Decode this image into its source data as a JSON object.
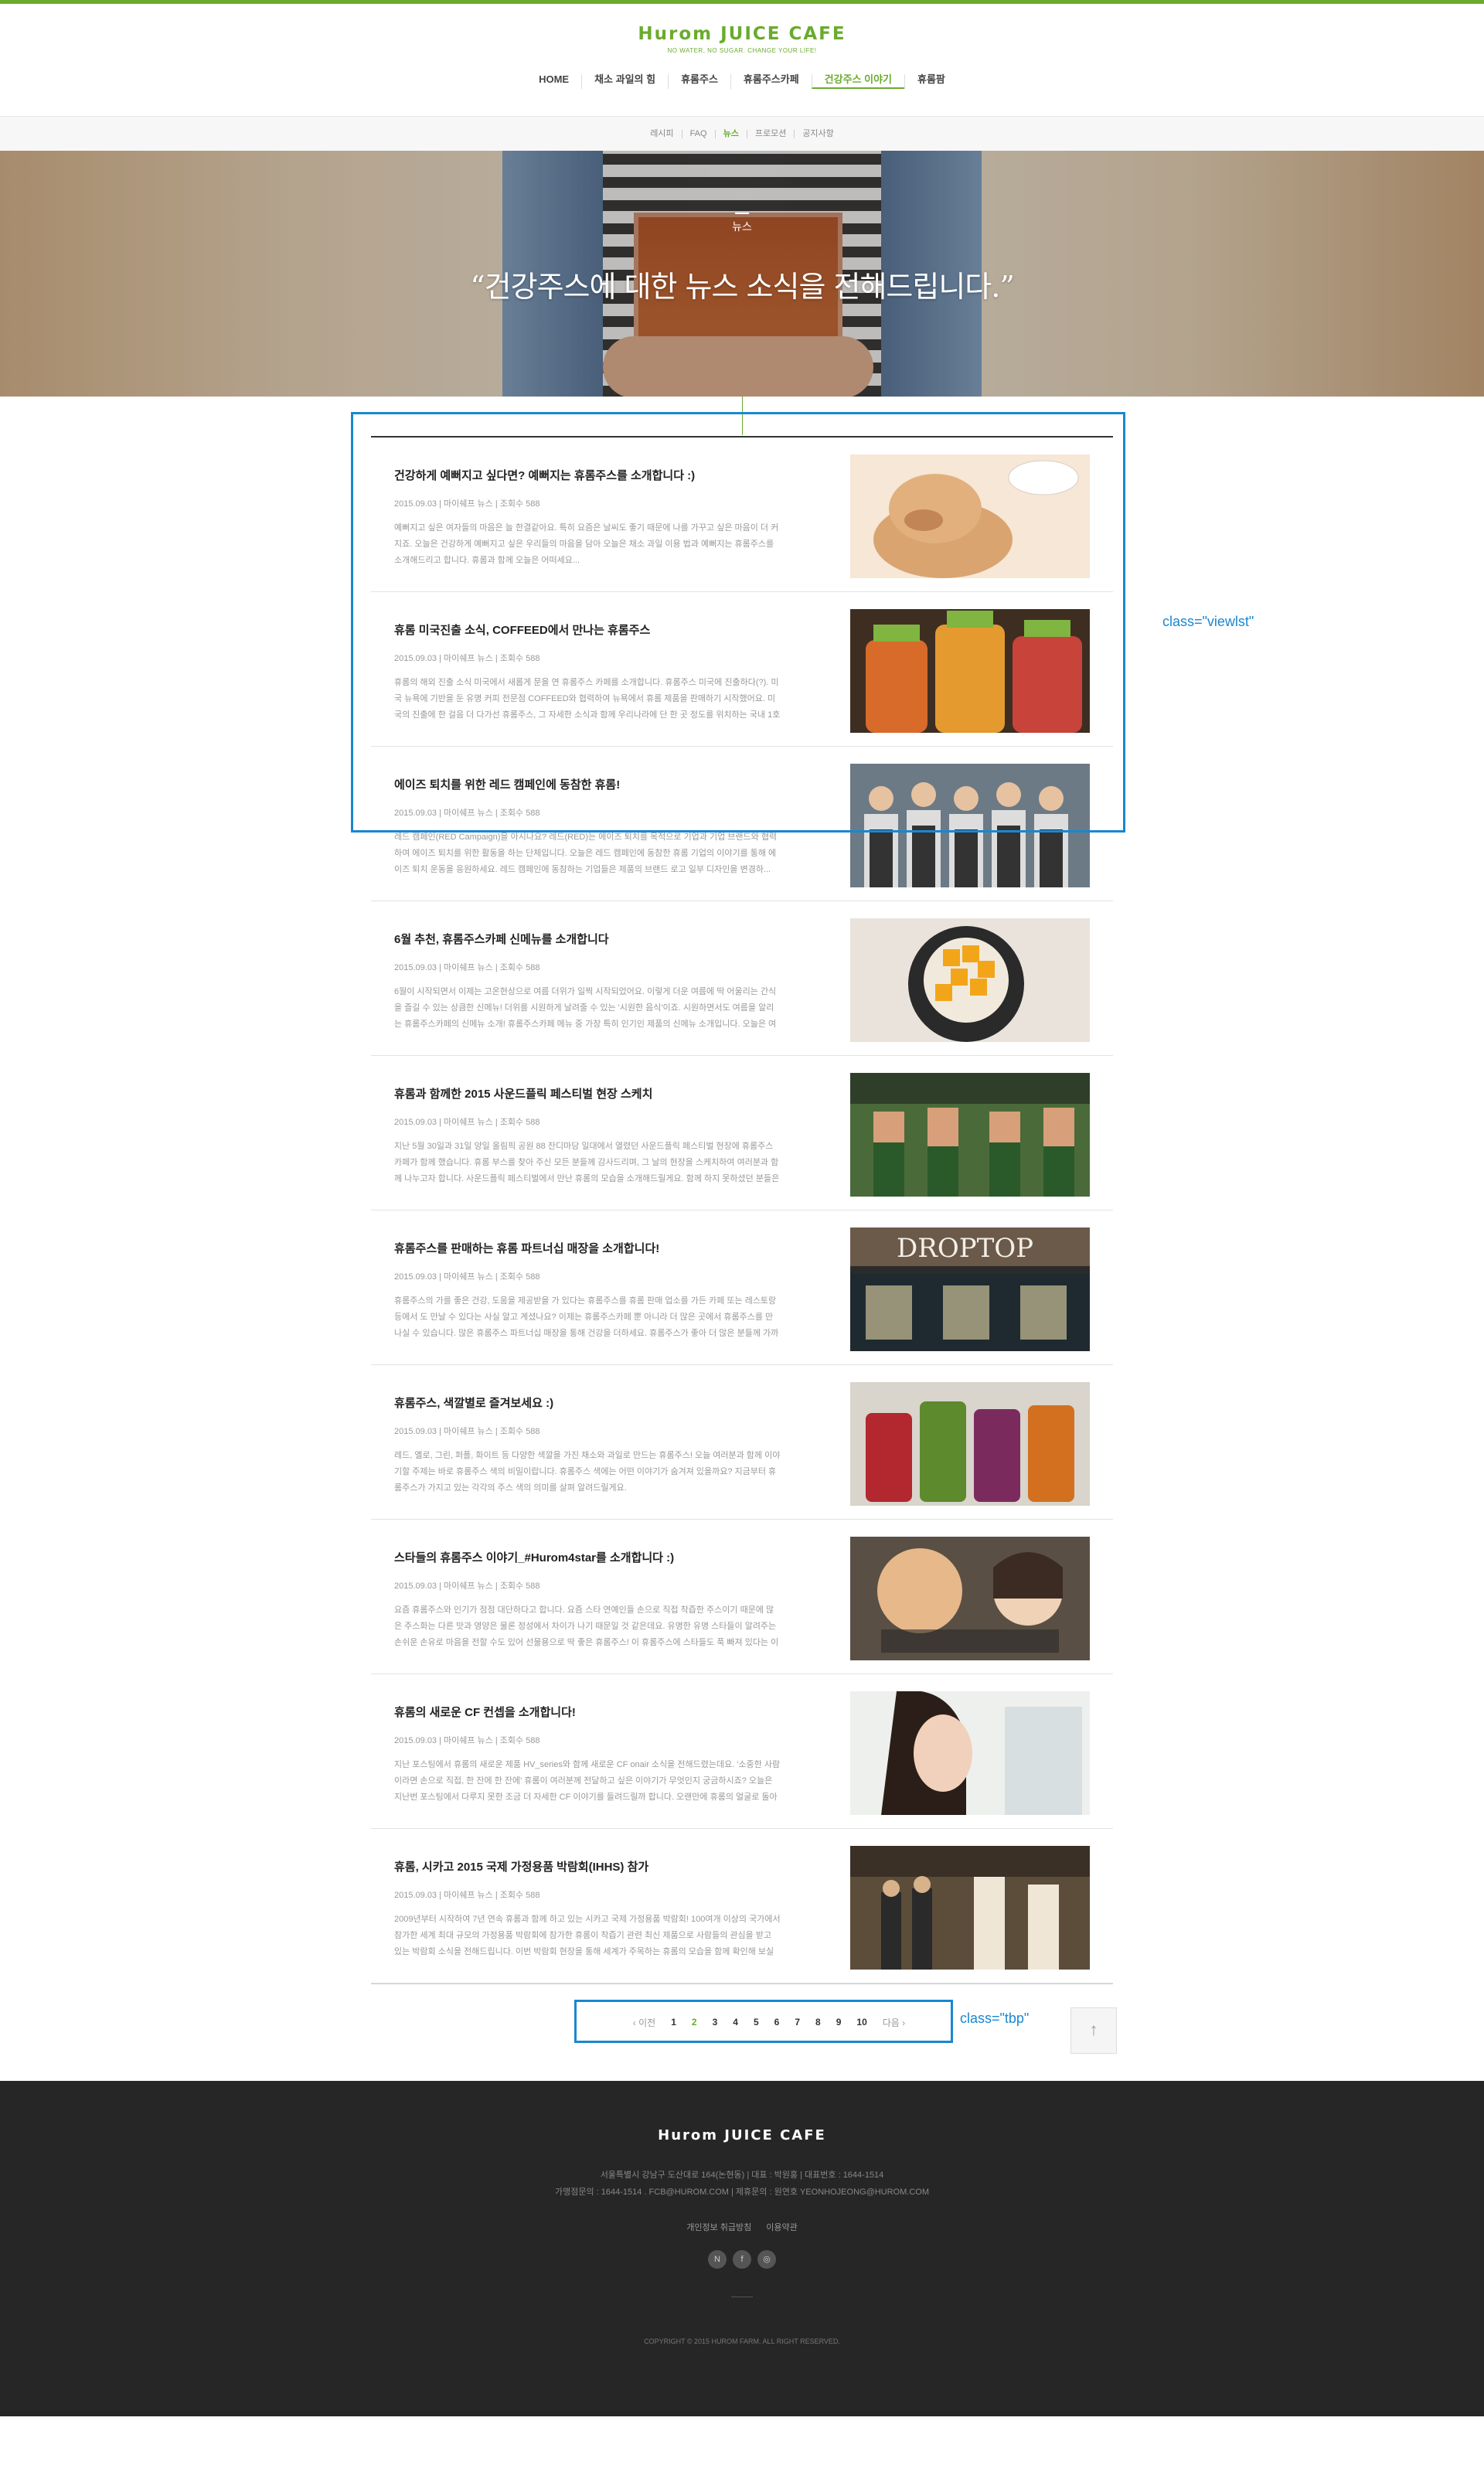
{
  "brand": {
    "logo": "Hurom JUICE CAFE",
    "tagline": "NO WATER, NO SUGAR. CHANGE YOUR LIFE!",
    "accent": "#6aab2e"
  },
  "gnb": [
    "HOME",
    "채소 과일의 힘",
    "휴롬주스",
    "휴롬주스카페",
    "건강주스 이야기",
    "휴롬팜"
  ],
  "subnav": [
    "레시피",
    "FAQ",
    "뉴스",
    "프로모션",
    "공지사항"
  ],
  "hero": {
    "badge": "뉴스",
    "quote": "“건강주스에 대한 뉴스 소식을 전해드립니다.”"
  },
  "annotations": {
    "list": "class=\"viewlst\"",
    "pager": "class=\"tbp\""
  },
  "articles": [
    {
      "title": "건강하게 예뻐지고 싶다면? 예뻐지는 휴롬주스를 소개합니다 :)",
      "meta": "2015.09.03 | 마이쉐프 뉴스 | 조회수 588",
      "body": "예뻐지고 싶은 여자들의 마음은 늘 한결같아요. 특히 요즘은 날씨도 좋기 때문에 나를 가꾸고 싶은 마음이 더 커지죠. 오늘은 건강하게 예뻐지고 싶은 우리들의 마음을 담아 오늘은 채소 과일 이용 법과 예뻐지는 휴롬주스를 소개해드리고 합니다. 휴롬과 함께 오늘은 어떠세요..."
    },
    {
      "title": "휴롬 미국진출 소식, COFFEED에서 만나는 휴롬주스",
      "meta": "2015.09.03 | 마이쉐프 뉴스 | 조회수 588",
      "body": "휴롬의 해외 진출 소식 미국에서 새롭게 문을 연 휴롬주스 카페를 소개합니다. 휴롬주스 미국에 진출하다(?). 미국 뉴욕에 기반을 둔 유명 커피 전문점 COFFEED와 협력하여 뉴욕에서 휴롬 제품을 판매하기 시작했어요. 미국의 진출에 한 걸음 더 다가선 휴롬주스, 그 자세한 소식과 함께 우리나라에 단 한 곳 정도를 위치하는 국내 1호점 카페도 소개..."
    },
    {
      "title": "에이즈 퇴치를 위한 레드 캠페인에 동참한 휴롬!",
      "meta": "2015.09.03 | 마이쉐프 뉴스 | 조회수 588",
      "body": "레드 캠페인(RED Campaign)을 아시나요? 레드(RED)는 에이즈 퇴치를 목적으로 기업과 기업 브랜드와 협력하여 에이즈 퇴치를 위한 활동을 하는 단체입니다. 오늘은 레드 캠페인에 동참한 휴롬 기업의 이야기를 통해 에이즈 퇴치 운동을 응원하세요. 레드 캠페인에 동참하는 기업들은 제품의 브랜드 로고 일부 디자인을 변경하..."
    },
    {
      "title": "6월 추천, 휴롬주스카페 신메뉴를 소개합니다",
      "meta": "2015.09.03 | 마이쉐프 뉴스 | 조회수 588",
      "body": "6월이 시작되면서 이제는 고온현상으로 여름 더위가 일찍 시작되었어요. 이렇게 더운 여름에 딱 어울리는 간식을 즐길 수 있는 상큼한 신메뉴! 더위를 시원하게 날려줄 수 있는 '시원한 음식'이죠. 시원하면서도 여름을 알리는 휴롬주스카페의 신메뉴 소개! 휴롬주스카페 메뉴 중 가장 특히 인기인 제품의 신메뉴 소개입니다. 오늘은 여러분이 건강한 여름을 위해 휴롬주스카페에서 새로 나온 신메뉴..."
    },
    {
      "title": "휴롬과 함께한 2015 사운드플릭 페스티벌 현장 스케치",
      "meta": "2015.09.03 | 마이쉐프 뉴스 | 조회수 588",
      "body": "지난 5월 30일과 31일 양일 올림픽 공원 88 잔디마당 일대에서 열렸던 사운드플릭 페스티벌 현장에 휴롬주스카페가 함께 했습니다. 휴롬 부스를 찾아 주신 모든 분들께 감사드리며, 그 날의 현장을 스케치하여 여러분과 함께 나누고자 합니다. 사운드플릭 페스티벌에서 만난 휴롬의 모습을 소개해드릴게요. 함께 하지 못하셨던 분들은 휴롬이 들려드리는 사운드플릭 페스티벌 생..."
    },
    {
      "title": "휴롬주스를 판매하는 휴롬 파트너십 매장을 소개합니다!",
      "meta": "2015.09.03 | 마이쉐프 뉴스 | 조회수 588",
      "body": "휴롬주스의 가를 좋은 건강, 도움을 제공받을 가 있다는 휴롬주스를 휴롬 판매 업소를 가든 카페 또는 레스토랑 등에서 도 만날 수 있다는 사실 알고 계셨나요? 이제는 휴롬주스카페 뿐 아니라 더 많은 곳에서 휴롬주스를 만나실 수 있습니다. 많은 휴롬주스 파트너십 매장을 통해 건강을 더하세요. 휴롬주스가 좋아 더 많은 분들께 가까이 다가가고자 합은..."
    },
    {
      "title": "휴롬주스, 색깔별로 즐겨보세요 :)",
      "meta": "2015.09.03 | 마이쉐프 뉴스 | 조회수 588",
      "body": "레드, 옐로, 그린, 퍼플, 화이트 등 다양한 색깔을 가진 채소와 과일로 만드는 휴롬주스! 오늘 여러분과 함께 이야기할 주제는 바로 휴롬주스 색의 비밀이랍니다. 휴롬주스 색에는 어떤 이야기가 숨겨져 있을까요? 지금부터 휴롬주스가 가지고 있는 각각의 주스 색의 의미를 살펴 알려드릴게요."
    },
    {
      "title": "스타들의 휴롬주스 이야기_#Hurom4star를 소개합니다 :)",
      "meta": "2015.09.03 | 마이쉐프 뉴스 | 조회수 588",
      "body": "요즘 휴롬주스와 인기가 점점 대단하다고 합니다. 요즘 스타 연예인들 손으로 직접 착즙한 주스이기 때문에 많은 주스화는 다른 맛과 영양은 물론 정성에서 차이가 나기 때문일 것 같은데요. 유명한 유명 스타들이 알려주는 손쉬운 손유로 마음을 전할 수도 있어 선물용으로 딱 좋은 휴롬주스! 이 휴롬주스에 스타들도 푹 빠져 있다는 이야..."
    },
    {
      "title": "휴롬의 새로운 CF 컨셉을 소개합니다!",
      "meta": "2015.09.03 | 마이쉐프 뉴스 | 조회수 588",
      "body": "지난 포스팅에서 휴롬의 새로운 제품 HV_series와 함께 새로운 CF onair 소식을 전해드렸는데요. '소중한 사람이라면 손으로 직접, 한 잔에 한 잔에' 휴롬이 여러분께 전달하고 싶은 이야기가 무엇인지 궁금하시죠? 오늘은 지난번 포스팅에서 다루지 못한 조금 더 자세한 CF 이야기를 들려드릴까 합니다. 오랜만에 휴롬의 얼굴로 돌아온..."
    },
    {
      "title": "휴롬, 시카고 2015 국제 가정용품 박람회(IHHS) 참가",
      "meta": "2015.09.03 | 마이쉐프 뉴스 | 조회수 588",
      "body": "2009년부터 시작하여 7년 연속 휴롬과 함께 하고 있는 시카고 국제 가정용품 박람회! 100여개 이상의 국가에서 참가한 세계 최대 규모의 가정용품 박람회에 참가한 휴롬이 착즙기 관련 최신 제품으로 사람들의 관심을 받고 있는 박람회 소식을 전해드립니다. 이번 박람회 현장을 통해 세계가 주목하는 휴롬의 모습을 함께 확인해 보실 수 있어요. 이번 박람회는 세계인들에게 휴롬주스의 우수성을..."
    }
  ],
  "pager": {
    "prev": "‹ 이전",
    "pages": [
      "1",
      "2",
      "3",
      "4",
      "5",
      "6",
      "7",
      "8",
      "9",
      "10"
    ],
    "current": "2",
    "next": "다음 ›"
  },
  "footer": {
    "logo": "Hurom JUICE CAFE",
    "addr1": "서울특별시 강남구 도산대로 164(논현동) | 대표 : 박원홍 | 대표번호 : 1644-1514",
    "addr2": "가맹점문의 : 1644-1514 . FCB@HUROM.COM | 제휴문의 : 원연호 YEONHOJEONG@HUROM.COM",
    "links": [
      "개인정보 취급방침",
      "이용약관"
    ],
    "sns": [
      "N",
      "f",
      "◎"
    ],
    "copyright": "COPYRIGHT © 2015 HUROM FARM. ALL RIGHT RESERVED."
  }
}
